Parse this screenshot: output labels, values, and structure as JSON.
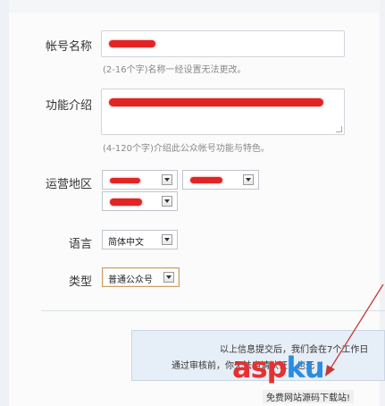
{
  "form": {
    "account_name": {
      "label": "帐号名称",
      "hint": "(2-16个字)名称一经设置无法更改。"
    },
    "description": {
      "label": "功能介绍",
      "hint": "(4-120个字)介绍此公众帐号功能与特色。"
    },
    "region": {
      "label": "运营地区"
    },
    "language": {
      "label": "语言",
      "value": "简体中文"
    },
    "type": {
      "label": "类型",
      "value": "普通公众号"
    }
  },
  "notice": {
    "line1": "以上信息提交后，我们会在7个工作日",
    "line2": "通过审核前，你无法申请认证，也无"
  },
  "watermark": {
    "brand_a": "asp",
    "brand_b": "ku",
    "sub": "免费网站源码下载站!"
  },
  "colors": {
    "redaction": "#e12424",
    "notice_bg": "#e6eef7",
    "arrow": "#c43a3a"
  }
}
